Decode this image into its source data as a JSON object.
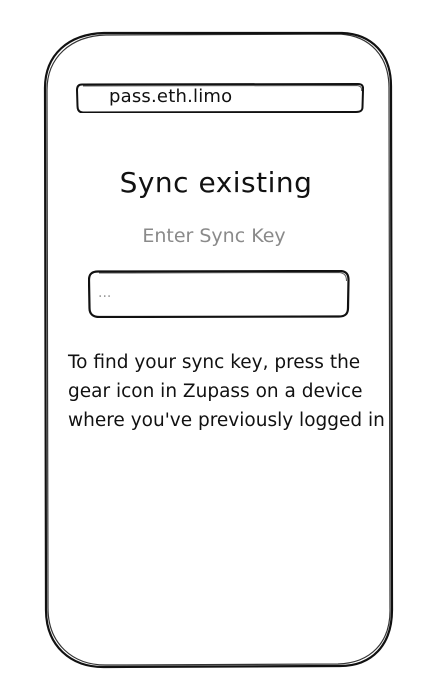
{
  "browser": {
    "url": "pass.eth.limo"
  },
  "sync_page": {
    "title": "Sync existing",
    "subtitle": "Enter Sync Key",
    "sync_key_input": {
      "value": "",
      "placeholder": "..."
    },
    "help_text": "To find your sync key, press the gear icon in Zupass on a device where you've previously logged in"
  }
}
